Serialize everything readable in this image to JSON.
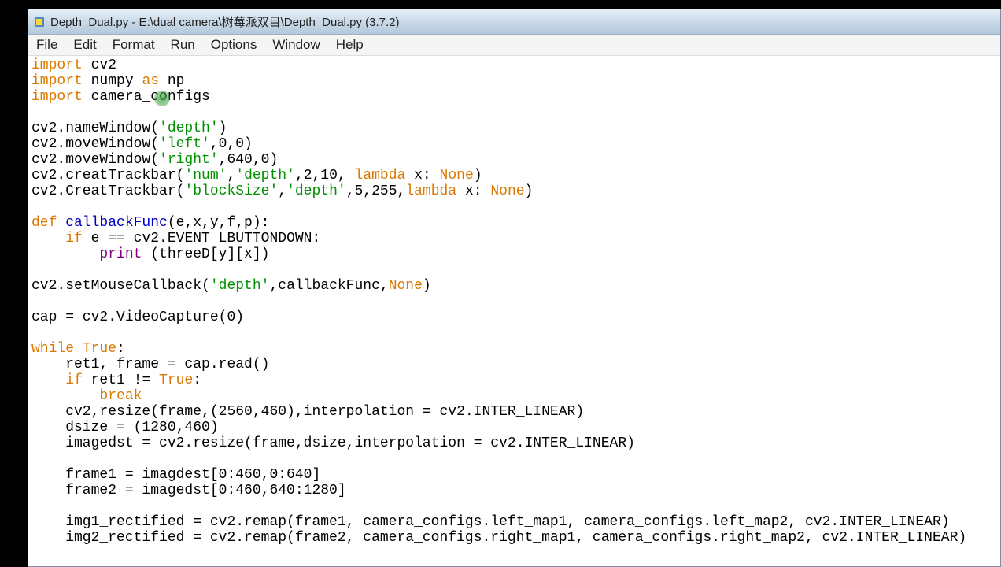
{
  "window": {
    "title": "Depth_Dual.py - E:\\dual camera\\树莓派双目\\Depth_Dual.py (3.7.2)"
  },
  "menu": {
    "file": "File",
    "edit": "Edit",
    "format": "Format",
    "run": "Run",
    "options": "Options",
    "window": "Window",
    "help": "Help"
  },
  "code": {
    "l1_import": "import",
    "l1_rest": " cv2",
    "l2_import": "import",
    "l2_numpy": " numpy ",
    "l2_as": "as",
    "l2_np": " np",
    "l3_import": "import",
    "l3_rest": " camera_configs",
    "l5a": "cv2.nameWindow(",
    "l5b": "'depth'",
    "l5c": ")",
    "l6a": "cv2.moveWindow(",
    "l6b": "'left'",
    "l6c": ",0,0)",
    "l7a": "cv2.moveWindow(",
    "l7b": "'right'",
    "l7c": ",640,0)",
    "l8a": "cv2.creatTrackbar(",
    "l8b": "'num'",
    "l8c": ",",
    "l8d": "'depth'",
    "l8e": ",2,10, ",
    "l8f": "lambda",
    "l8g": " x: ",
    "l8h": "None",
    "l8i": ")",
    "l9a": "cv2.CreatTrackbar(",
    "l9b": "'blockSize'",
    "l9c": ",",
    "l9d": "'depth'",
    "l9e": ",5,255,",
    "l9f": "lambda",
    "l9g": " x: ",
    "l9h": "None",
    "l9i": ")",
    "l11a": "def",
    "l11b": " ",
    "l11c": "callbackFunc",
    "l11d": "(e,x,y,f,p):",
    "l12a": "    ",
    "l12b": "if",
    "l12c": " e == cv2.EVENT_LBUTTONDOWN:",
    "l13a": "        ",
    "l13b": "print",
    "l13c": " (threeD[y][x])",
    "l15a": "cv2.setMouseCallback(",
    "l15b": "'depth'",
    "l15c": ",callbackFunc,",
    "l15d": "None",
    "l15e": ")",
    "l17": "cap = cv2.VideoCapture(0)",
    "l19a": "while",
    "l19b": " ",
    "l19c": "True",
    "l19d": ":",
    "l20": "    ret1, frame = cap.read()",
    "l21a": "    ",
    "l21b": "if",
    "l21c": " ret1 != ",
    "l21d": "True",
    "l21e": ":",
    "l22a": "        ",
    "l22b": "break",
    "l23": "    cv2,resize(frame,(2560,460),interpolation = cv2.INTER_LINEAR)",
    "l24": "    dsize = (1280,460)",
    "l25": "    imagedst = cv2.resize(frame,dsize,interpolation = cv2.INTER_LINEAR)",
    "l27": "    frame1 = imagdest[0:460,0:640]",
    "l28": "    frame2 = imagedst[0:460,640:1280]",
    "l30": "    img1_rectified = cv2.remap(frame1, camera_configs.left_map1, camera_configs.left_map2, cv2.INTER_LINEAR)",
    "l31": "    img2_rectified = cv2.remap(frame2, camera_configs.right_map1, camera_configs.right_map2, cv2.INTER_LINEAR)"
  }
}
